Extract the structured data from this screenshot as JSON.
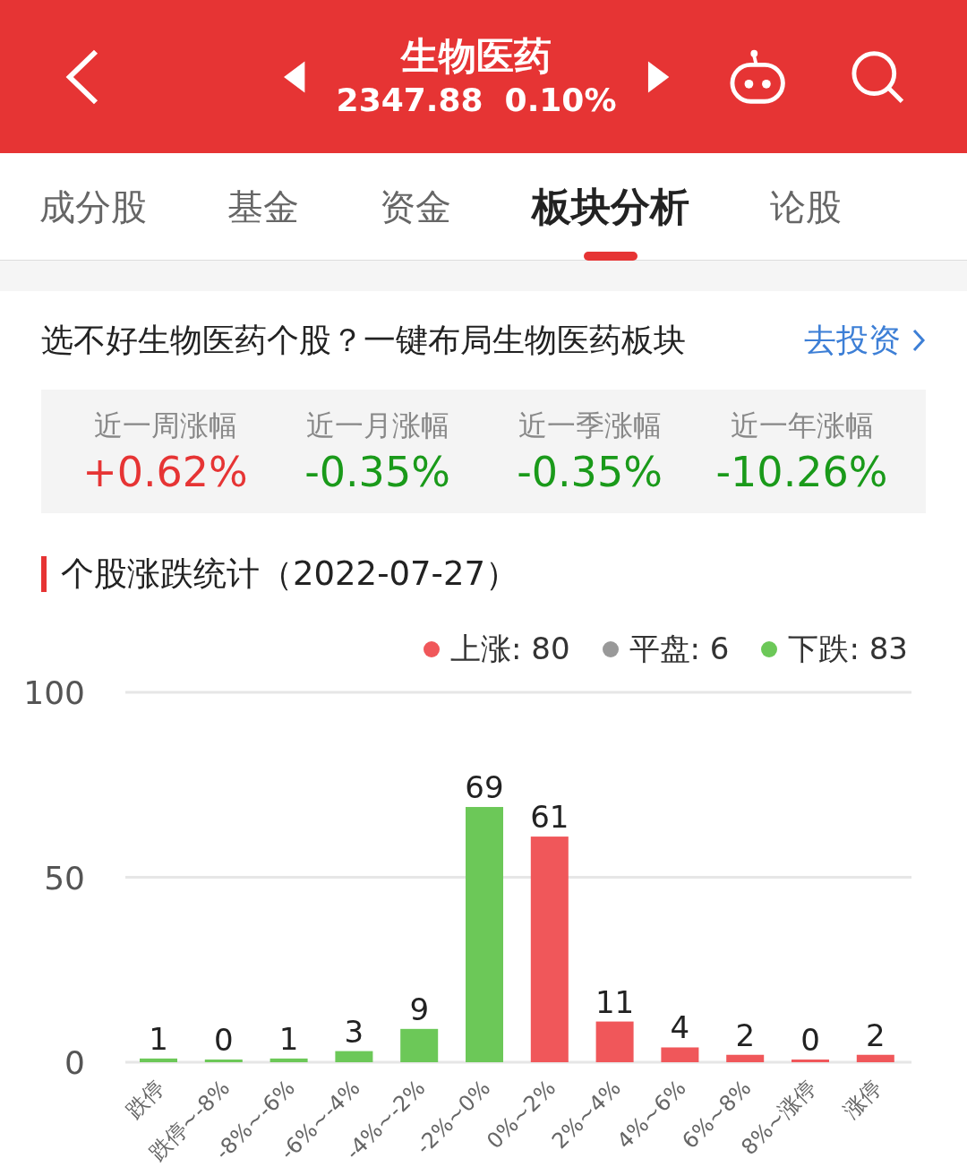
{
  "header": {
    "title": "生物医药",
    "price": "2347.88",
    "change": "0.10%"
  },
  "tabs": [
    {
      "label": "成分股",
      "selected": false
    },
    {
      "label": "基金",
      "selected": false
    },
    {
      "label": "资金",
      "selected": false
    },
    {
      "label": "板块分析",
      "selected": true
    },
    {
      "label": "论股",
      "selected": false
    }
  ],
  "promo": {
    "text": "选不好生物医药个股？一键布局生物医药板块",
    "link": "去投资"
  },
  "stats": [
    {
      "label": "近一周涨幅",
      "value": "+0.62%",
      "color": "#e63434"
    },
    {
      "label": "近一月涨幅",
      "value": "-0.35%",
      "color": "#1a9a1a"
    },
    {
      "label": "近一季涨幅",
      "value": "-0.35%",
      "color": "#1a9a1a"
    },
    {
      "label": "近一年涨幅",
      "value": "-10.26%",
      "color": "#1a9a1a"
    }
  ],
  "section_title": "个股涨跌统计（2022-07-27）",
  "legend": [
    {
      "label": "上涨: 80",
      "color": "#f0575a"
    },
    {
      "label": "平盘: 6",
      "color": "#999999"
    },
    {
      "label": "下跌: 83",
      "color": "#6cc858"
    }
  ],
  "chart_data": {
    "type": "bar",
    "categories": [
      "跌停",
      "跌停~-8%",
      "-8%~-6%",
      "-6%~-4%",
      "-4%~-2%",
      "-2%~0%",
      "0%~2%",
      "2%~4%",
      "4%~6%",
      "6%~8%",
      "8%~涨停",
      "涨停"
    ],
    "series": [
      {
        "color": "#6cc858",
        "values": [
          1,
          0,
          1,
          3,
          9,
          69,
          null,
          null,
          null,
          null,
          null,
          null
        ]
      },
      {
        "color": "#f0575a",
        "values": [
          null,
          null,
          null,
          null,
          null,
          null,
          61,
          11,
          4,
          2,
          0,
          2
        ]
      }
    ],
    "ylim": [
      0,
      100
    ],
    "yticks": [
      0,
      50,
      100
    ],
    "data_labels": true
  }
}
